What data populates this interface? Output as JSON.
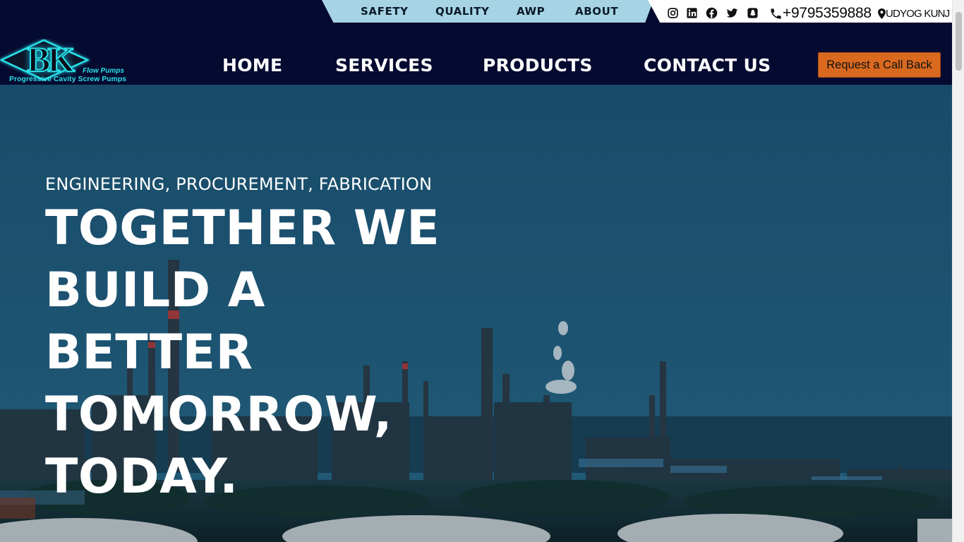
{
  "topbar": {
    "links": [
      "SAFETY",
      "QUALITY",
      "AWP",
      "ABOUT"
    ]
  },
  "contact": {
    "phone": "+9795359888",
    "location": "UDYOG KUNJ",
    "social_icons": [
      "instagram-icon",
      "linkedin-icon",
      "facebook-icon",
      "twitter-icon",
      "snapchat-icon"
    ]
  },
  "logo": {
    "mark": "BK",
    "line1": "Flow Pumps",
    "line2": "Progressive Cavity Screw Pumps"
  },
  "nav": {
    "home": "HOME",
    "services": "SERVICES",
    "products": "PRODUCTS",
    "contact": "CONTACT US"
  },
  "cta": {
    "label": "Request a Call Back"
  },
  "hero": {
    "kicker": "ENGINEERING, PROCUREMENT, FABRICATION",
    "title": "TOGETHER WE BUILD A BETTER TOMORROW, TODAY."
  },
  "colors": {
    "header_bg": "#050a30",
    "topbar_bg": "#a7d4e4",
    "cta_bg": "#d9691f",
    "logo_cyan": "#2ae0e8"
  }
}
